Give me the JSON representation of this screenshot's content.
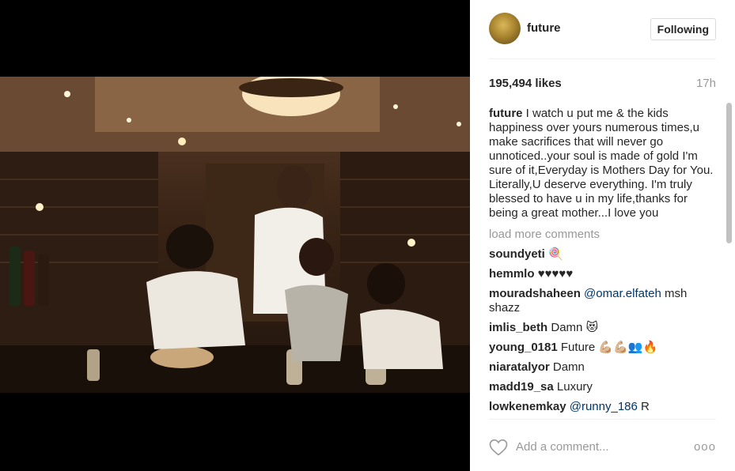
{
  "post": {
    "username": "future",
    "follow_label": "Following",
    "likes": "195,494 likes",
    "time": "17h",
    "caption_user": "future",
    "caption_text": "I watch u put me & the kids happiness over yours numerous times,u make sacrifices that will never go unnoticed..your soul is made of gold I'm sure of it,Everyday is Mothers Day for You. Literally,U deserve everything. I'm truly blessed to have u in my life,thanks for being a great mother...I love you",
    "load_more": "load more comments"
  },
  "comments": [
    {
      "user": "soundyeti",
      "text": "🍭"
    },
    {
      "user": "hemmlo",
      "text": "♥♥♥♥♥"
    },
    {
      "user": "mouradshaheen",
      "mention": "@omar.elfateh",
      "text": "msh shazz"
    },
    {
      "user": "imlis_beth",
      "text": "Damn 😻"
    },
    {
      "user": "young_0181",
      "text": "Future 💪🏼💪🏼👥🔥"
    },
    {
      "user": "niaratalyor",
      "text": "Damn"
    },
    {
      "user": "madd19_sa",
      "text": "Luxury"
    },
    {
      "user": "lowkenemkay",
      "mention": "@runny_186",
      "text": "R"
    }
  ],
  "footer": {
    "add_comment_placeholder": "Add a comment...",
    "more_label": "ooo"
  },
  "icons": {
    "like": "heart-icon",
    "options": "more-options-icon"
  },
  "colors": {
    "text": "#262626",
    "muted": "#999999",
    "mention": "#003569",
    "border": "#dbdbdb"
  }
}
